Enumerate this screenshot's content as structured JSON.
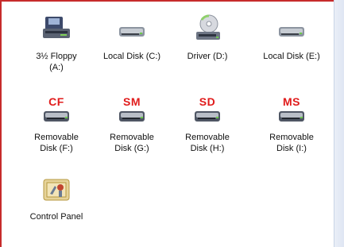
{
  "drives": [
    {
      "label": "3½ Floppy\n(A:)",
      "icon": "floppy-drive-icon"
    },
    {
      "label": "Local Disk (C:)",
      "icon": "hard-disk-icon"
    },
    {
      "label": "Driver (D:)",
      "icon": "cd-drive-icon"
    },
    {
      "label": "Local Disk (E:)",
      "icon": "hard-disk-icon"
    },
    {
      "label": "Removable\nDisk (F:)",
      "badge": "CF",
      "icon": "removable-disk-icon"
    },
    {
      "label": "Removable\nDisk (G:)",
      "badge": "SM",
      "icon": "removable-disk-icon"
    },
    {
      "label": "Removable\nDisk (H:)",
      "badge": "SD",
      "icon": "removable-disk-icon"
    },
    {
      "label": "Removable\nDisk (I:)",
      "badge": "MS",
      "icon": "removable-disk-icon"
    },
    {
      "label": "Control Panel",
      "icon": "control-panel-icon"
    }
  ],
  "colors": {
    "border_accent": "#c72b2b",
    "badge": "#e01b1b"
  }
}
